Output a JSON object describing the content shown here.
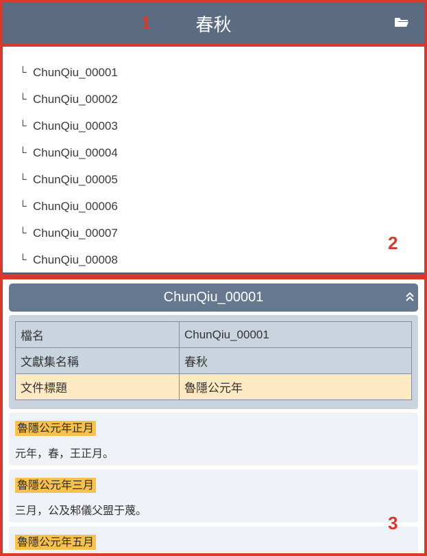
{
  "header": {
    "title": "春秋",
    "folder_icon": "folder-open-icon"
  },
  "files": [
    "ChunQiu_00001",
    "ChunQiu_00002",
    "ChunQiu_00003",
    "ChunQiu_00004",
    "ChunQiu_00005",
    "ChunQiu_00006",
    "ChunQiu_00007",
    "ChunQiu_00008"
  ],
  "branch_glyph": "└",
  "detail": {
    "title": "ChunQiu_00001",
    "collapse_icon": "chevron-double-up-icon",
    "meta": [
      {
        "key": "檔名",
        "value": "ChunQiu_00001"
      },
      {
        "key": "文獻集名稱",
        "value": "春秋"
      },
      {
        "key": "文件標題",
        "value": "魯隱公元年"
      }
    ],
    "entries": [
      {
        "tag": "魯隱公元年正月",
        "text": "元年，春，王正月。"
      },
      {
        "tag": "魯隱公元年三月",
        "text": "三月，公及邾儀父盟于蔑。"
      },
      {
        "tag": "魯隱公元年五月",
        "text": ""
      }
    ]
  },
  "annotations": {
    "region1": "1",
    "region2": "2",
    "region3": "3"
  },
  "colors": {
    "header_bg": "#5a6b82",
    "panel_header_bg": "#66788f",
    "meta_bg": "#c9d4df",
    "highlight_row": "#fde9c2",
    "tag_bg": "#f7c14c",
    "annotation": "#d9392b"
  }
}
